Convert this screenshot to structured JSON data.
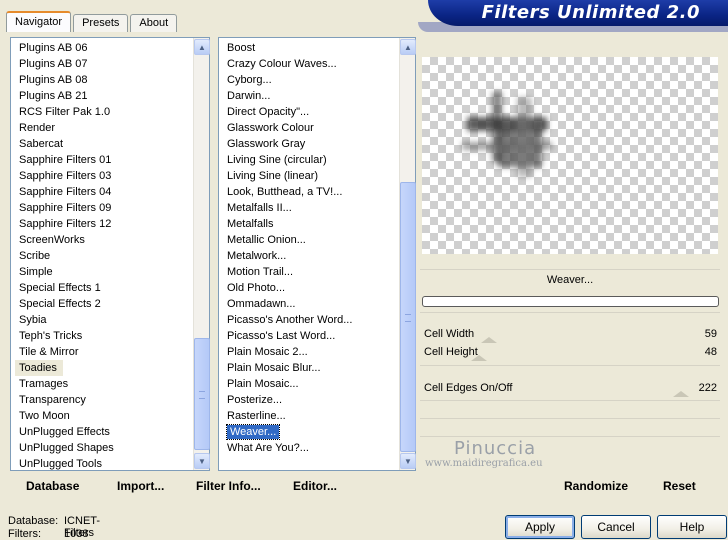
{
  "tabs": [
    "Navigator",
    "Presets",
    "About"
  ],
  "banner_title": "Filters Unlimited 2.0",
  "categories": [
    "Plugins AB 06",
    "Plugins AB 07",
    "Plugins AB 08",
    "Plugins AB 21",
    "RCS Filter Pak 1.0",
    "Render",
    "Sabercat",
    "Sapphire Filters 01",
    "Sapphire Filters 03",
    "Sapphire Filters 04",
    "Sapphire Filters 09",
    "Sapphire Filters 12",
    "ScreenWorks",
    "Scribe",
    "Simple",
    "Special Effects 1",
    "Special Effects 2",
    "Sybia",
    "Teph's Tricks",
    "Tile & Mirror",
    "Toadies",
    "Tramages",
    "Transparency",
    "Two Moon",
    "UnPlugged Effects",
    "UnPlugged Shapes",
    "UnPlugged Tools"
  ],
  "selected_category": "Toadies",
  "filters": [
    "Boost",
    "Crazy Colour Waves...",
    "Cyborg...",
    "Darwin...",
    "Direct Opacity\"...",
    "Glasswork Colour",
    "Glasswork Gray",
    "Living Sine (circular)",
    "Living Sine (linear)",
    "Look, Butthead, a TV!...",
    "Metalfalls II...",
    "Metalfalls",
    "Metallic Onion...",
    "Metalwork...",
    "Motion Trail...",
    "Old Photo...",
    "Ommadawn...",
    "Picasso's Another Word...",
    "Picasso's Last Word...",
    "Plain Mosaic 2...",
    "Plain Mosaic Blur...",
    "Plain Mosaic...",
    "Posterize...",
    "Rasterline...",
    "Weaver...",
    "What Are You?..."
  ],
  "selected_filter": "Weaver...",
  "filter_name": "Weaver...",
  "params": [
    {
      "label": "Cell Width",
      "value": "59"
    },
    {
      "label": "Cell Height",
      "value": "48"
    },
    {
      "label": "Cell Edges On/Off",
      "value": "222"
    }
  ],
  "bottom_left": {
    "database": "Database",
    "import": "Import...",
    "filter_info": "Filter Info...",
    "editor": "Editor..."
  },
  "bottom_right": {
    "randomize": "Randomize",
    "reset": "Reset"
  },
  "status": {
    "database_label": "Database:",
    "database_value": "ICNET-Filters",
    "filters_label": "Filters:",
    "filters_value": "1038"
  },
  "buttons": {
    "apply": "Apply",
    "cancel": "Cancel",
    "help": "Help"
  },
  "watermark": {
    "name": "Pinuccia",
    "url": "www.maidiregrafica.eu"
  }
}
